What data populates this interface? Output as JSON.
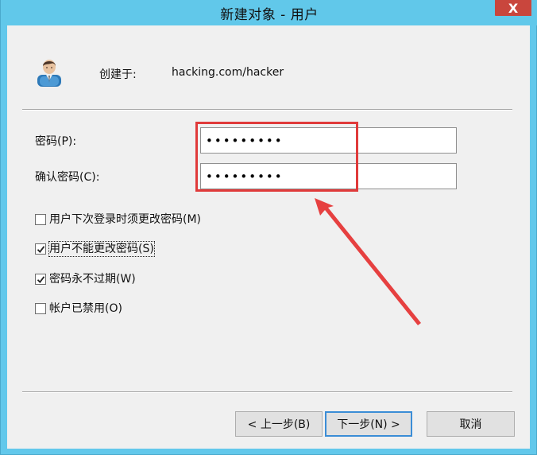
{
  "window": {
    "title": "新建对象 - 用户",
    "close_symbol": "X"
  },
  "header": {
    "icon": "user-icon",
    "created_label": "创建于:",
    "created_path": "hacking.com/hacker"
  },
  "form": {
    "password_label": "密码(P):",
    "password_value": "•••••••••",
    "confirm_label": "确认密码(C):",
    "confirm_value": "•••••••••"
  },
  "options": [
    {
      "label": "用户下次登录时须更改密码(M)",
      "checked": false
    },
    {
      "label": "用户不能更改密码(S)",
      "checked": true
    },
    {
      "label": "密码永不过期(W)",
      "checked": true
    },
    {
      "label": "帐户已禁用(O)",
      "checked": false
    }
  ],
  "buttons": {
    "back": "< 上一步(B)",
    "next": "下一步(N) >",
    "cancel": "取消"
  },
  "colors": {
    "title_bar": "#61c8ea",
    "close_button": "#c9463d",
    "annotation": "#e03a3a",
    "dialog_bg": "#f0f0f0"
  }
}
